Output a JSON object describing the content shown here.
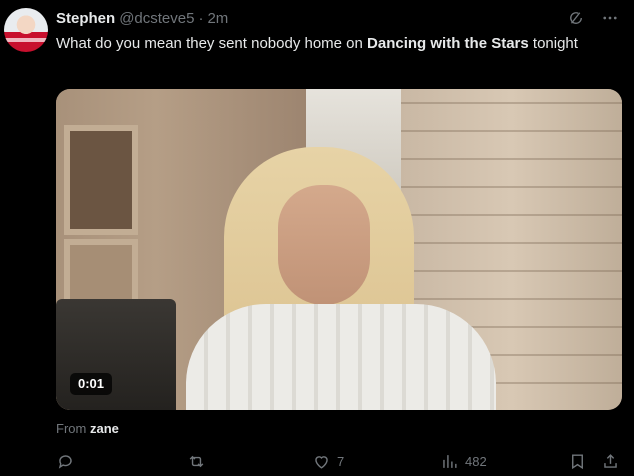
{
  "tweet": {
    "author_name": "Stephen",
    "handle": "@dcsteve5",
    "separator": "·",
    "time": "2m",
    "text_before": "What do you mean they sent nobody home on ",
    "text_bold": "Dancing with the Stars",
    "text_after": " tonight"
  },
  "media": {
    "video_time": "0:01",
    "from_prefix": "From",
    "from_source": "zane"
  },
  "actions": {
    "reply_count": "",
    "retweet_count": "",
    "like_count": "7",
    "views_count": "482"
  },
  "icons": {
    "grok": "grok-icon",
    "more": "more-icon",
    "reply": "reply-icon",
    "retweet": "retweet-icon",
    "like": "heart-icon",
    "views": "views-icon",
    "bookmark": "bookmark-icon",
    "share": "share-icon"
  },
  "colors": {
    "background": "#000000",
    "text": "#e7e9ea",
    "muted": "#71767b"
  }
}
